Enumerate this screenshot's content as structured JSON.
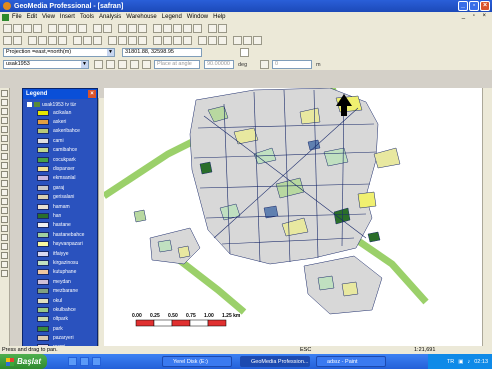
{
  "window": {
    "title": "GeoMedia Professional - [safran]"
  },
  "menu": [
    "File",
    "Edit",
    "View",
    "Insert",
    "Tools",
    "Analysis",
    "Warehouse",
    "Legend",
    "Window",
    "Help"
  ],
  "mdi_controls": "_ ▫ ×",
  "toolbar3": {
    "projection": "Projection =east,=north(m)",
    "coords": "31801.88, 32598.95"
  },
  "toolbar4": {
    "layer": "usak1953",
    "angle_placeholder": "Place at angle",
    "angle": "90.00000",
    "angle_unit": "deg",
    "value": "0",
    "value_unit": "m"
  },
  "legend": {
    "title": "Legend",
    "group": "usak1953 tv tür",
    "items": [
      {
        "label": "acikalan",
        "color": "#e6e600"
      },
      {
        "label": "askeri",
        "color": "#e4a040"
      },
      {
        "label": "askeribahce",
        "color": "#b8c878"
      },
      {
        "label": "cami",
        "color": "#e0e0e0"
      },
      {
        "label": "camibahce",
        "color": "#c0d890"
      },
      {
        "label": "cocukpark",
        "color": "#48a048"
      },
      {
        "label": "dispanser",
        "color": "#f0e090"
      },
      {
        "label": "ekmsanlal",
        "color": "#c8b8e0"
      },
      {
        "label": "garaj",
        "color": "#c8c8c8"
      },
      {
        "label": "gerisalani",
        "color": "#d8d0b0"
      },
      {
        "label": "hamam",
        "color": "#e8e0d0"
      },
      {
        "label": "han",
        "color": "#2a6e2a"
      },
      {
        "label": "hastane",
        "color": "#f0f0f0"
      },
      {
        "label": "hastanebahce",
        "color": "#a0d0a0"
      },
      {
        "label": "hayvanpazari",
        "color": "#f8f8a0"
      },
      {
        "label": "itfaiyye",
        "color": "#d8d8f0"
      },
      {
        "label": "kirgazinosu",
        "color": "#c0e0c0"
      },
      {
        "label": "kutuphane",
        "color": "#f0c8a0"
      },
      {
        "label": "meydan",
        "color": "#d0c0d8"
      },
      {
        "label": "mezbarane",
        "color": "#80a080"
      },
      {
        "label": "okul",
        "color": "#e0e0c0"
      },
      {
        "label": "okulbahce",
        "color": "#98c888"
      },
      {
        "label": "oltpark",
        "color": "#c8d8a8"
      },
      {
        "label": "park",
        "color": "#3a8a3a"
      },
      {
        "label": "pazaryeri",
        "color": "#d8c8b0"
      },
      {
        "label": "resmi",
        "color": "#e8d8e8"
      },
      {
        "label": "resmibahce",
        "color": "#b0c890"
      }
    ]
  },
  "map": {
    "scale_labels": [
      "0.00",
      "0.25",
      "0.50",
      "0.75",
      "1.00",
      "1.25 km"
    ]
  },
  "status": {
    "hint": "Press and drag to pan.",
    "mode": "ESC",
    "scale": "1:21,691"
  },
  "taskbar": {
    "start": "Başlat",
    "tasks": [
      "Yerel Disk (E:)",
      "GeoMedia Profession...",
      "adsız - Paint"
    ],
    "lang": "TR",
    "clock": "02:13"
  }
}
